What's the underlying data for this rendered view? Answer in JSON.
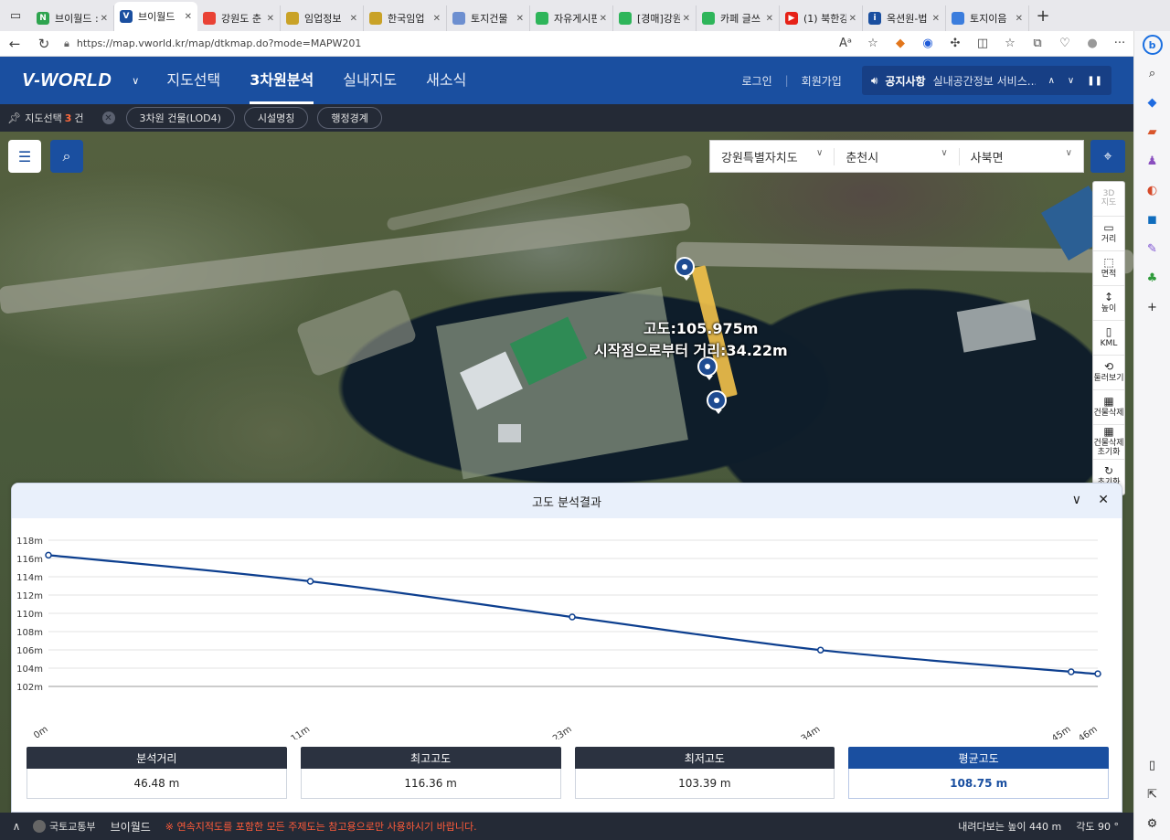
{
  "browser": {
    "tabs": [
      {
        "label": "브이월드 :",
        "icon_color": "#2ea44f",
        "icon_text": "N",
        "active": false
      },
      {
        "label": "브이월드",
        "icon_color": "#1a4fa0",
        "icon_text": "V",
        "active": true
      },
      {
        "label": "강원도 춘",
        "icon_color": "#e94235",
        "icon_text": "",
        "active": false
      },
      {
        "label": "임업정보",
        "icon_color": "#c9a227",
        "icon_text": "",
        "active": false
      },
      {
        "label": "한국임업",
        "icon_color": "#c9a227",
        "icon_text": "",
        "active": false
      },
      {
        "label": "토지건물",
        "icon_color": "#6d8fd0",
        "icon_text": "",
        "active": false
      },
      {
        "label": "자유게시판",
        "icon_color": "#2eb55a",
        "icon_text": "",
        "active": false
      },
      {
        "label": "[경매]강원",
        "icon_color": "#2eb55a",
        "icon_text": "",
        "active": false
      },
      {
        "label": "카페 글쓰",
        "icon_color": "#2eb55a",
        "icon_text": "",
        "active": false
      },
      {
        "label": "(1) 북한강",
        "icon_color": "#e62117",
        "icon_text": "▶",
        "active": false
      },
      {
        "label": "옥션원-법",
        "icon_color": "#1a4fa0",
        "icon_text": "i",
        "active": false
      },
      {
        "label": "토지이음",
        "icon_color": "#3b7ddd",
        "icon_text": "",
        "active": false
      }
    ],
    "url": "https://map.vworld.kr/map/dtkmap.do?mode=MAPW201"
  },
  "header": {
    "logo": "V-WORLD",
    "nav": [
      "지도선택",
      "3차원분석",
      "실내지도",
      "새소식"
    ],
    "active_nav": 1,
    "login": "로그인",
    "signup": "회원가입",
    "notice_label": "공지사항",
    "notice_text": "실내공간정보 서비스..."
  },
  "filterbar": {
    "label": "지도선택",
    "count": "3",
    "unit": "건",
    "chips": [
      "3차원 건물(LOD4)",
      "시설명칭",
      "행정경계"
    ]
  },
  "map": {
    "region": [
      "강원특별자치도",
      "춘천시",
      "사북면"
    ],
    "tools": [
      {
        "label": "3D\n지도",
        "icon": "",
        "disabled": true
      },
      {
        "label": "거리",
        "icon": "ruler-icon"
      },
      {
        "label": "면적",
        "icon": "area-icon"
      },
      {
        "label": "높이",
        "icon": "height-icon"
      },
      {
        "label": "KML",
        "icon": "file-icon"
      },
      {
        "label": "둘러보기",
        "icon": "rotate-icon"
      },
      {
        "label": "건물삭제",
        "icon": "building-delete-icon"
      },
      {
        "label": "건물삭제\n초기화",
        "icon": "building-reset-icon"
      },
      {
        "label": "초기화",
        "icon": "refresh-icon"
      }
    ],
    "measure_label_1": "고도:105.975m",
    "measure_label_2": "시작점으로부터 거리:34.22m"
  },
  "panel": {
    "title": "고도 분석결과"
  },
  "chart_data": {
    "type": "line",
    "title": "",
    "xlabel": "",
    "ylabel": "",
    "x_tick_labels": [
      "0m",
      "11m",
      "23m",
      "34m",
      "45m",
      "46m"
    ],
    "y_tick_labels": [
      "102m",
      "104m",
      "106m",
      "108m",
      "110m",
      "112m",
      "114m",
      "116m",
      "118m"
    ],
    "ylim": [
      102,
      118
    ],
    "series": [
      {
        "name": "",
        "color": "#0d3f8f",
        "x": [
          0,
          11.6,
          23.2,
          34.2,
          45.3,
          46.48
        ],
        "y": [
          116.36,
          113.5,
          109.6,
          105.98,
          103.6,
          103.39
        ]
      }
    ],
    "grid": true
  },
  "stats": [
    {
      "label": "분석거리",
      "value": "46.48 m"
    },
    {
      "label": "최고고도",
      "value": "116.36 m"
    },
    {
      "label": "최저고도",
      "value": "103.39 m"
    },
    {
      "label": "평균고도",
      "value": "108.75 m",
      "accent": true
    }
  ],
  "footer": {
    "ministry": "국토교통부",
    "brand": "브이월드",
    "warning": "※ 연속지적도를 포함한 모든 주제도는 참고용으로만 사용하시기 바랍니다.",
    "altitude": "내려다보는 높이 440 m",
    "angle": "각도 90 °"
  }
}
